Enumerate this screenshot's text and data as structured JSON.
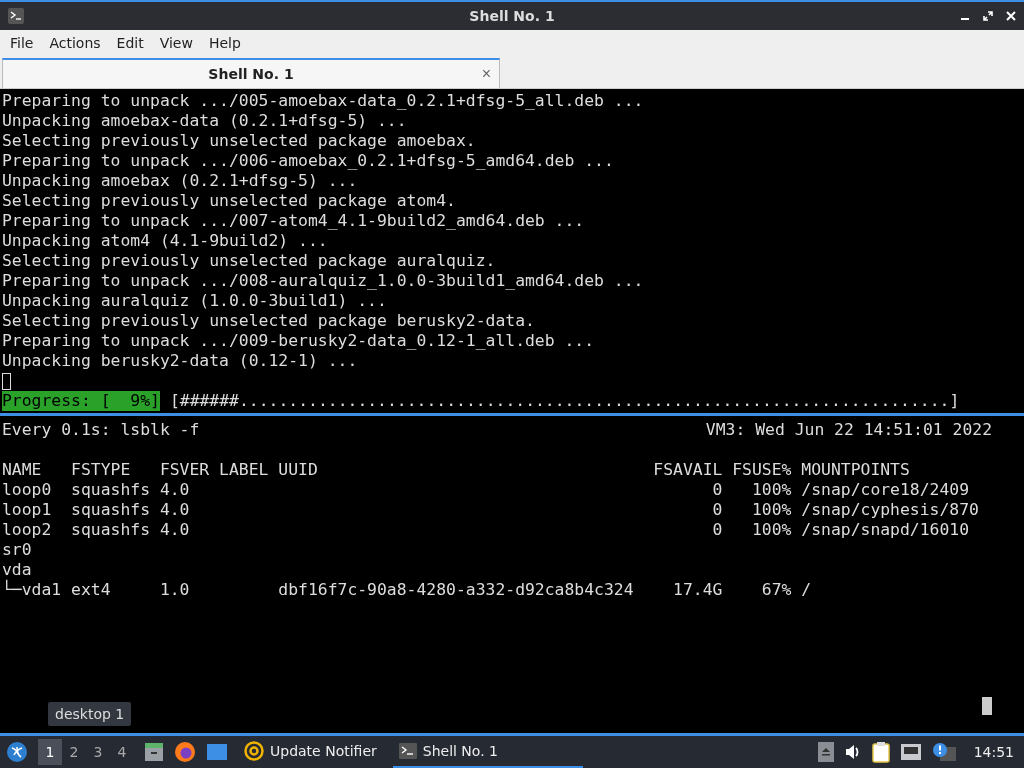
{
  "window": {
    "title": "Shell No. 1"
  },
  "menu": [
    "File",
    "Actions",
    "Edit",
    "View",
    "Help"
  ],
  "tabs": [
    {
      "label": "Shell No. 1",
      "selected": true,
      "close": "×"
    }
  ],
  "top_pane": {
    "lines": [
      "Preparing to unpack .../005-amoebax-data_0.2.1+dfsg-5_all.deb ...",
      "Unpacking amoebax-data (0.2.1+dfsg-5) ...",
      "Selecting previously unselected package amoebax.",
      "Preparing to unpack .../006-amoebax_0.2.1+dfsg-5_amd64.deb ...",
      "Unpacking amoebax (0.2.1+dfsg-5) ...",
      "Selecting previously unselected package atom4.",
      "Preparing to unpack .../007-atom4_4.1-9build2_amd64.deb ...",
      "Unpacking atom4 (4.1-9build2) ...",
      "Selecting previously unselected package auralquiz.",
      "Preparing to unpack .../008-auralquiz_1.0.0-3build1_amd64.deb ...",
      "Unpacking auralquiz (1.0.0-3build1) ...",
      "Selecting previously unselected package berusky2-data.",
      "Preparing to unpack .../009-berusky2-data_0.12-1_all.deb ...",
      "Unpacking berusky2-data (0.12-1) ..."
    ],
    "progress_label": "Progress: [  9%]",
    "progress_bar": "[######........................................................................]"
  },
  "bottom_pane": {
    "command": "Every 0.1s: lsblk -f",
    "host_time": "VM3: Wed Jun 22 14:51:01 2022",
    "lines": [
      "NAME   FSTYPE   FSVER LABEL UUID                                  FSAVAIL FSUSE% MOUNTPOINTS",
      "loop0  squashfs 4.0                                                     0   100% /snap/core18/2409",
      "loop1  squashfs 4.0                                                     0   100% /snap/cyphesis/870",
      "loop2  squashfs 4.0                                                     0   100% /snap/snapd/16010",
      "sr0",
      "vda",
      "└─vda1 ext4     1.0         dbf16f7c-90a8-4280-a332-d92ca8b4c324    17.4G    67% /"
    ]
  },
  "taskbar": {
    "workspaces": [
      {
        "label": "1",
        "selected": true
      },
      {
        "label": "2",
        "selected": false
      },
      {
        "label": "3",
        "selected": false
      },
      {
        "label": "4",
        "selected": false
      }
    ],
    "tooltip": "desktop 1",
    "tasks": [
      {
        "kind": "notifier",
        "label": "Update Notifier",
        "selected": false
      },
      {
        "kind": "terminal",
        "label": "Shell No. 1",
        "selected": true
      }
    ],
    "clock": "14:51"
  }
}
